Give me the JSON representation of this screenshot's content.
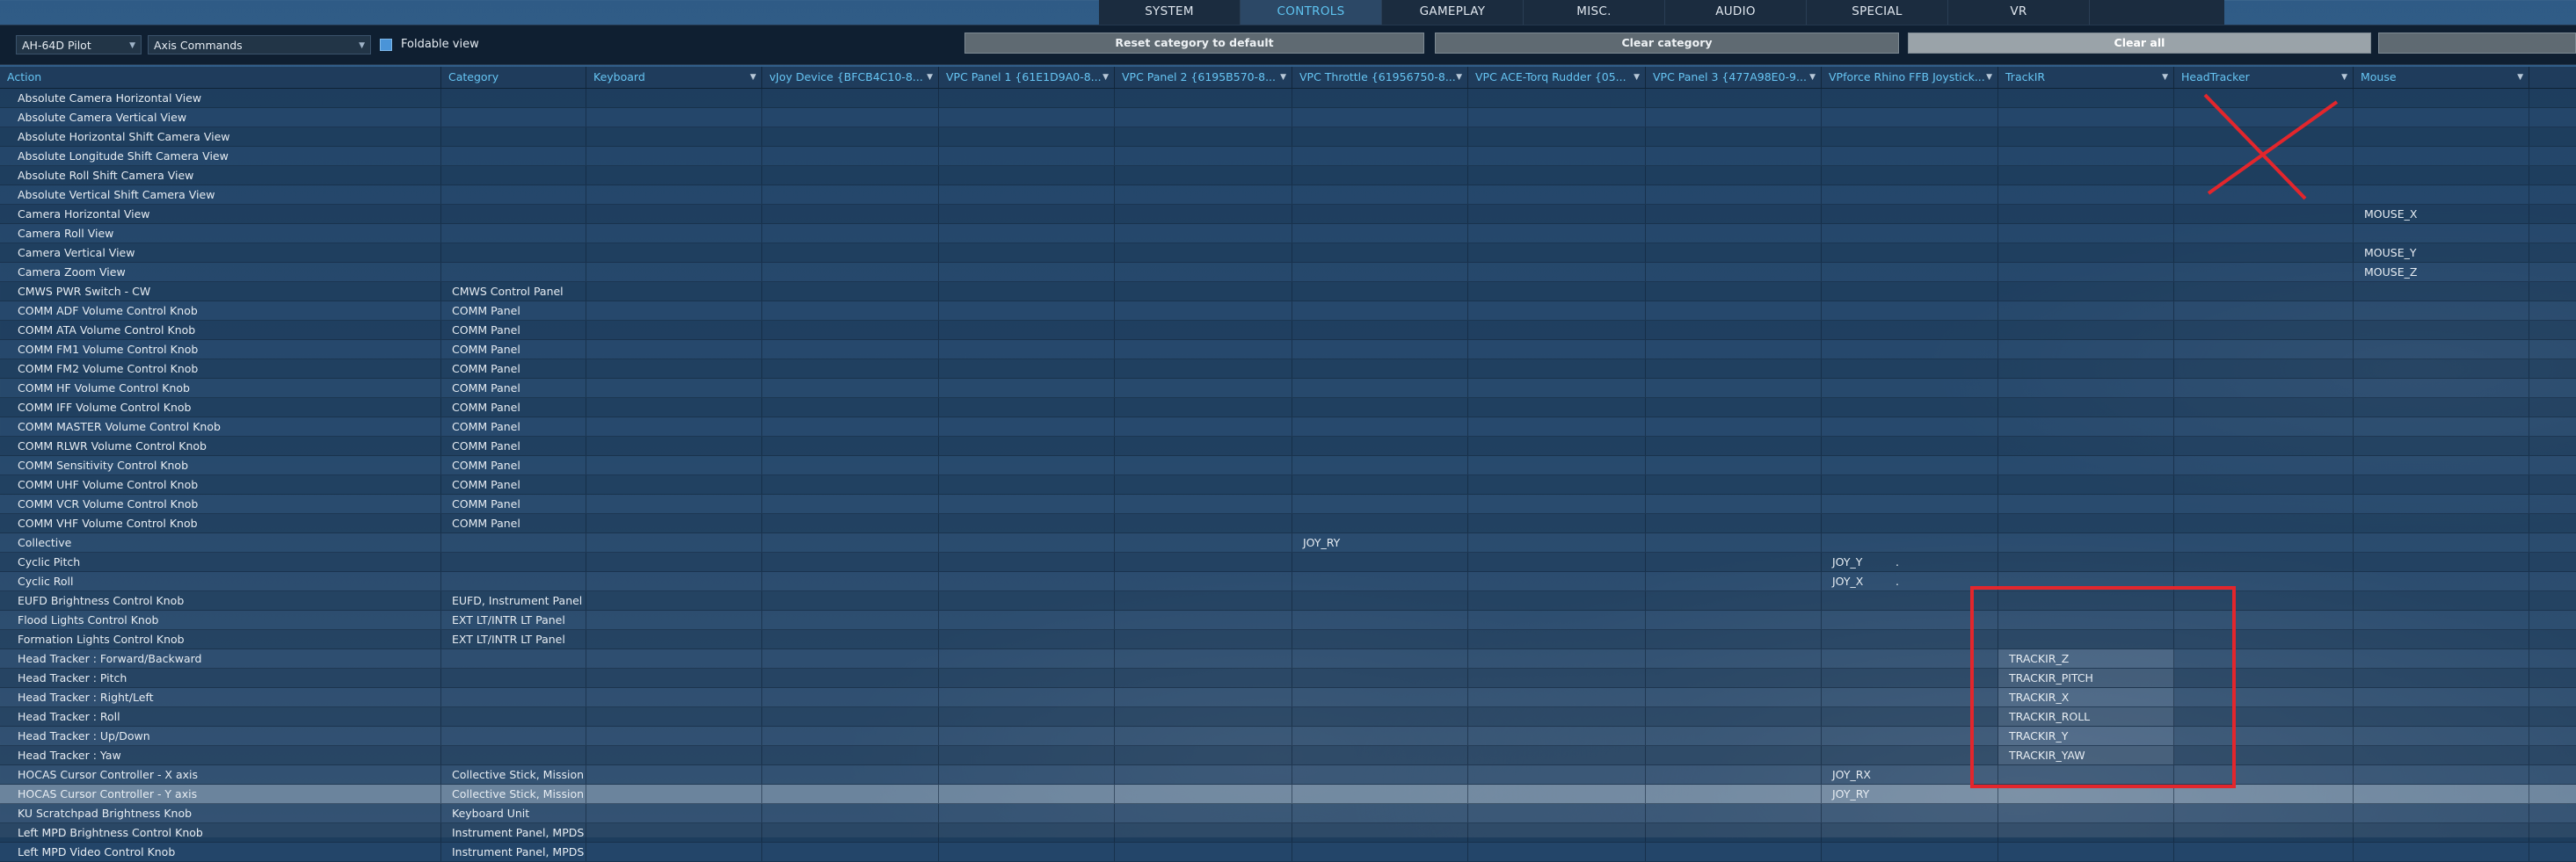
{
  "tabs": [
    "SYSTEM",
    "CONTROLS",
    "GAMEPLAY",
    "MISC.",
    "AUDIO",
    "SPECIAL",
    "VR"
  ],
  "active_tab": "CONTROLS",
  "toolbar": {
    "profile_value": "AH-64D Pilot",
    "category_value": "Axis Commands",
    "foldable_label": "Foldable view",
    "foldable_checked": true,
    "reset_label": "Reset category to default",
    "clear_category_label": "Clear category",
    "clear_all_label": "Clear all",
    "extra_button_label": ""
  },
  "columns": [
    "Action",
    "Category",
    "Keyboard",
    "vJoy Device {BFCB4C10-8...",
    "VPC Panel 1 {61E1D9A0-8...",
    "VPC Panel 2 {6195B570-8...",
    "VPC Throttle {61956750-8...",
    "VPC ACE-Torq Rudder {05...",
    "VPC Panel 3 {477A98E0-9...",
    "VPforce Rhino FFB Joystick...",
    "TrackIR",
    "HeadTracker",
    "Mouse"
  ],
  "rows": [
    {
      "action": "Absolute Camera Horizontal View",
      "category": "",
      "binds": {}
    },
    {
      "action": "Absolute Camera Vertical View",
      "category": "",
      "binds": {}
    },
    {
      "action": "Absolute Horizontal Shift Camera View",
      "category": "",
      "binds": {}
    },
    {
      "action": "Absolute Longitude Shift Camera View",
      "category": "",
      "binds": {}
    },
    {
      "action": "Absolute Roll Shift Camera View",
      "category": "",
      "binds": {}
    },
    {
      "action": "Absolute Vertical Shift Camera View",
      "category": "",
      "binds": {}
    },
    {
      "action": "Camera Horizontal View",
      "category": "",
      "binds": {
        "mouse": "MOUSE_X"
      }
    },
    {
      "action": "Camera Roll View",
      "category": "",
      "binds": {}
    },
    {
      "action": "Camera Vertical View",
      "category": "",
      "binds": {
        "mouse": "MOUSE_Y"
      }
    },
    {
      "action": "Camera Zoom View",
      "category": "",
      "binds": {
        "mouse": "MOUSE_Z"
      }
    },
    {
      "action": "CMWS PWR Switch - CW",
      "category": "CMWS Control Panel",
      "binds": {}
    },
    {
      "action": "COMM ADF Volume Control Knob",
      "category": "COMM Panel",
      "binds": {}
    },
    {
      "action": "COMM ATA Volume Control Knob",
      "category": "COMM Panel",
      "binds": {}
    },
    {
      "action": "COMM FM1 Volume Control Knob",
      "category": "COMM Panel",
      "binds": {}
    },
    {
      "action": "COMM FM2 Volume Control Knob",
      "category": "COMM Panel",
      "binds": {}
    },
    {
      "action": "COMM HF Volume Control Knob",
      "category": "COMM Panel",
      "binds": {}
    },
    {
      "action": "COMM IFF Volume Control Knob",
      "category": "COMM Panel",
      "binds": {}
    },
    {
      "action": "COMM MASTER Volume Control Knob",
      "category": "COMM Panel",
      "binds": {}
    },
    {
      "action": "COMM RLWR Volume Control Knob",
      "category": "COMM Panel",
      "binds": {}
    },
    {
      "action": "COMM Sensitivity Control Knob",
      "category": "COMM Panel",
      "binds": {}
    },
    {
      "action": "COMM UHF Volume Control Knob",
      "category": "COMM Panel",
      "binds": {}
    },
    {
      "action": "COMM VCR Volume Control Knob",
      "category": "COMM Panel",
      "binds": {}
    },
    {
      "action": "COMM VHF Volume Control Knob",
      "category": "COMM Panel",
      "binds": {}
    },
    {
      "action": "Collective",
      "category": "",
      "binds": {
        "throttle": "JOY_RY"
      }
    },
    {
      "action": "Cyclic Pitch",
      "category": "",
      "binds": {
        "rhino": "JOY_Y",
        "rhino_mark": "."
      }
    },
    {
      "action": "Cyclic Roll",
      "category": "",
      "binds": {
        "rhino": "JOY_X",
        "rhino_mark": "."
      }
    },
    {
      "action": "EUFD Brightness Control Knob",
      "category": "EUFD, Instrument Panel",
      "binds": {}
    },
    {
      "action": "Flood Lights Control Knob",
      "category": "EXT LT/INTR LT Panel",
      "binds": {}
    },
    {
      "action": "Formation Lights Control Knob",
      "category": "EXT LT/INTR LT Panel",
      "binds": {}
    },
    {
      "action": "Head Tracker : Forward/Backward",
      "category": "",
      "binds": {
        "trackir": "TRACKIR_Z"
      }
    },
    {
      "action": "Head Tracker : Pitch",
      "category": "",
      "binds": {
        "trackir": "TRACKIR_PITCH"
      }
    },
    {
      "action": "Head Tracker : Right/Left",
      "category": "",
      "binds": {
        "trackir": "TRACKIR_X"
      }
    },
    {
      "action": "Head Tracker : Roll",
      "category": "",
      "binds": {
        "trackir": "TRACKIR_ROLL"
      }
    },
    {
      "action": "Head Tracker : Up/Down",
      "category": "",
      "binds": {
        "trackir": "TRACKIR_Y"
      }
    },
    {
      "action": "Head Tracker : Yaw",
      "category": "",
      "binds": {
        "trackir": "TRACKIR_YAW"
      }
    },
    {
      "action": "HOCAS Cursor Controller - X axis",
      "category": "Collective Stick, Mission G",
      "binds": {
        "rhino": "JOY_RX"
      }
    },
    {
      "action": "HOCAS Cursor Controller - Y axis",
      "category": "Collective Stick, Mission G",
      "binds": {
        "rhino": "JOY_RY"
      },
      "highlighted": true
    },
    {
      "action": "KU Scratchpad Brightness Knob",
      "category": "Keyboard Unit",
      "binds": {}
    },
    {
      "action": "Left MPD Brightness Control Knob",
      "category": "Instrument Panel, MPDS",
      "binds": {}
    },
    {
      "action": "Left MPD Video Control Knob",
      "category": "Instrument Panel, MPDS",
      "binds": {}
    }
  ],
  "colors": {
    "accent": "#5ec3f0",
    "annotation_red": "#e3262c",
    "header_bg": "#1f3c5c",
    "toolbar_bg": "#0f1f31"
  },
  "icons": [
    "dropdown-arrow-icon",
    "checkbox-icon",
    "red-x-annotation",
    "red-box-annotation"
  ]
}
